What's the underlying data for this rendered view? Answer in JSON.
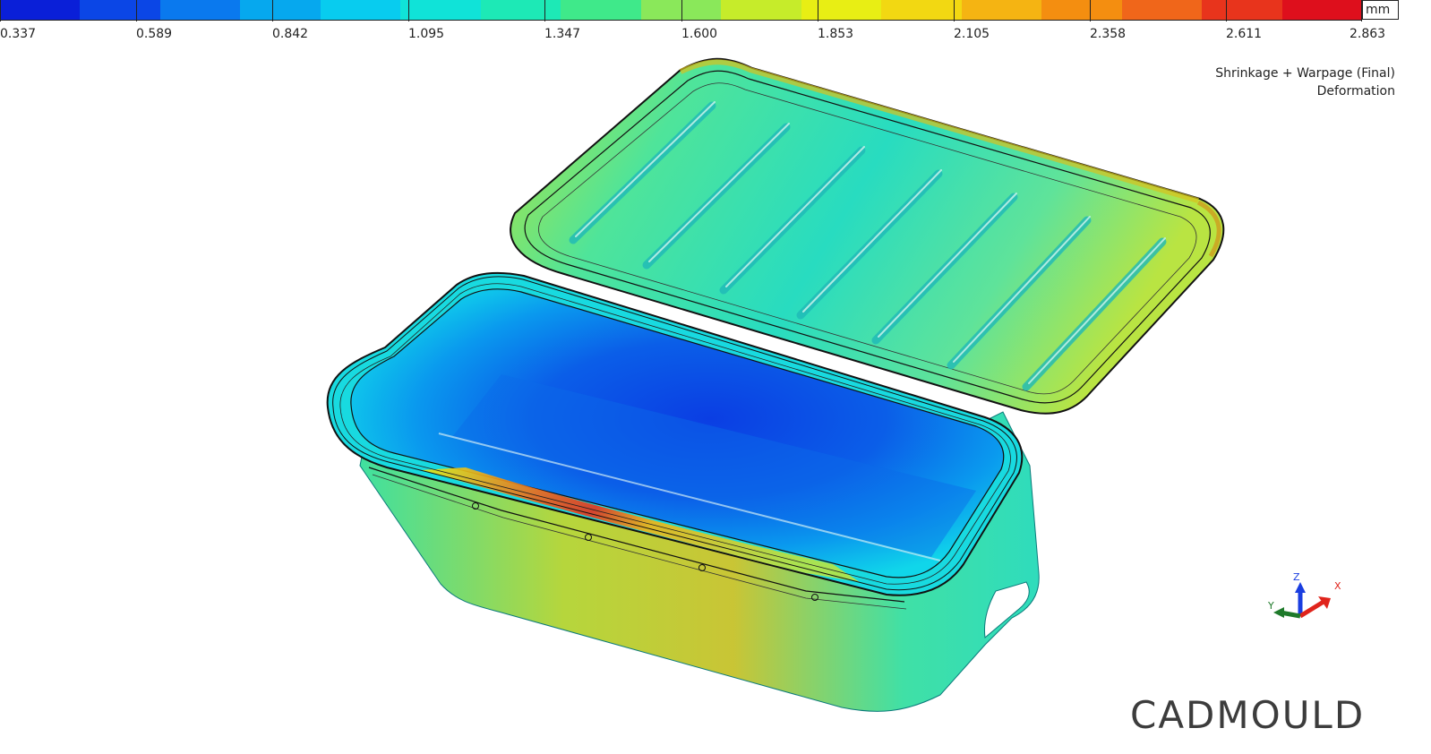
{
  "legend": {
    "unit": "mm",
    "ticks": [
      "0.337",
      "0.589",
      "0.842",
      "1.095",
      "1.347",
      "1.600",
      "1.853",
      "2.105",
      "2.358",
      "2.611",
      "2.863"
    ],
    "colors": [
      "#0a1fd8",
      "#0b46e6",
      "#0a79ee",
      "#06a8ee",
      "#08ccef",
      "#10e3d8",
      "#1de9b6",
      "#3fe98a",
      "#8ae85a",
      "#c6ec2a",
      "#e8ee14",
      "#f2d812",
      "#f5b412",
      "#f48e10",
      "#f0661a",
      "#e8341c",
      "#de0f1c"
    ]
  },
  "result": {
    "line1": "Shrinkage + Warpage (Final)",
    "line2": "Deformation"
  },
  "triad": {
    "z": "Z",
    "x": "X",
    "y": "Y"
  },
  "brand": "CADMOULD"
}
